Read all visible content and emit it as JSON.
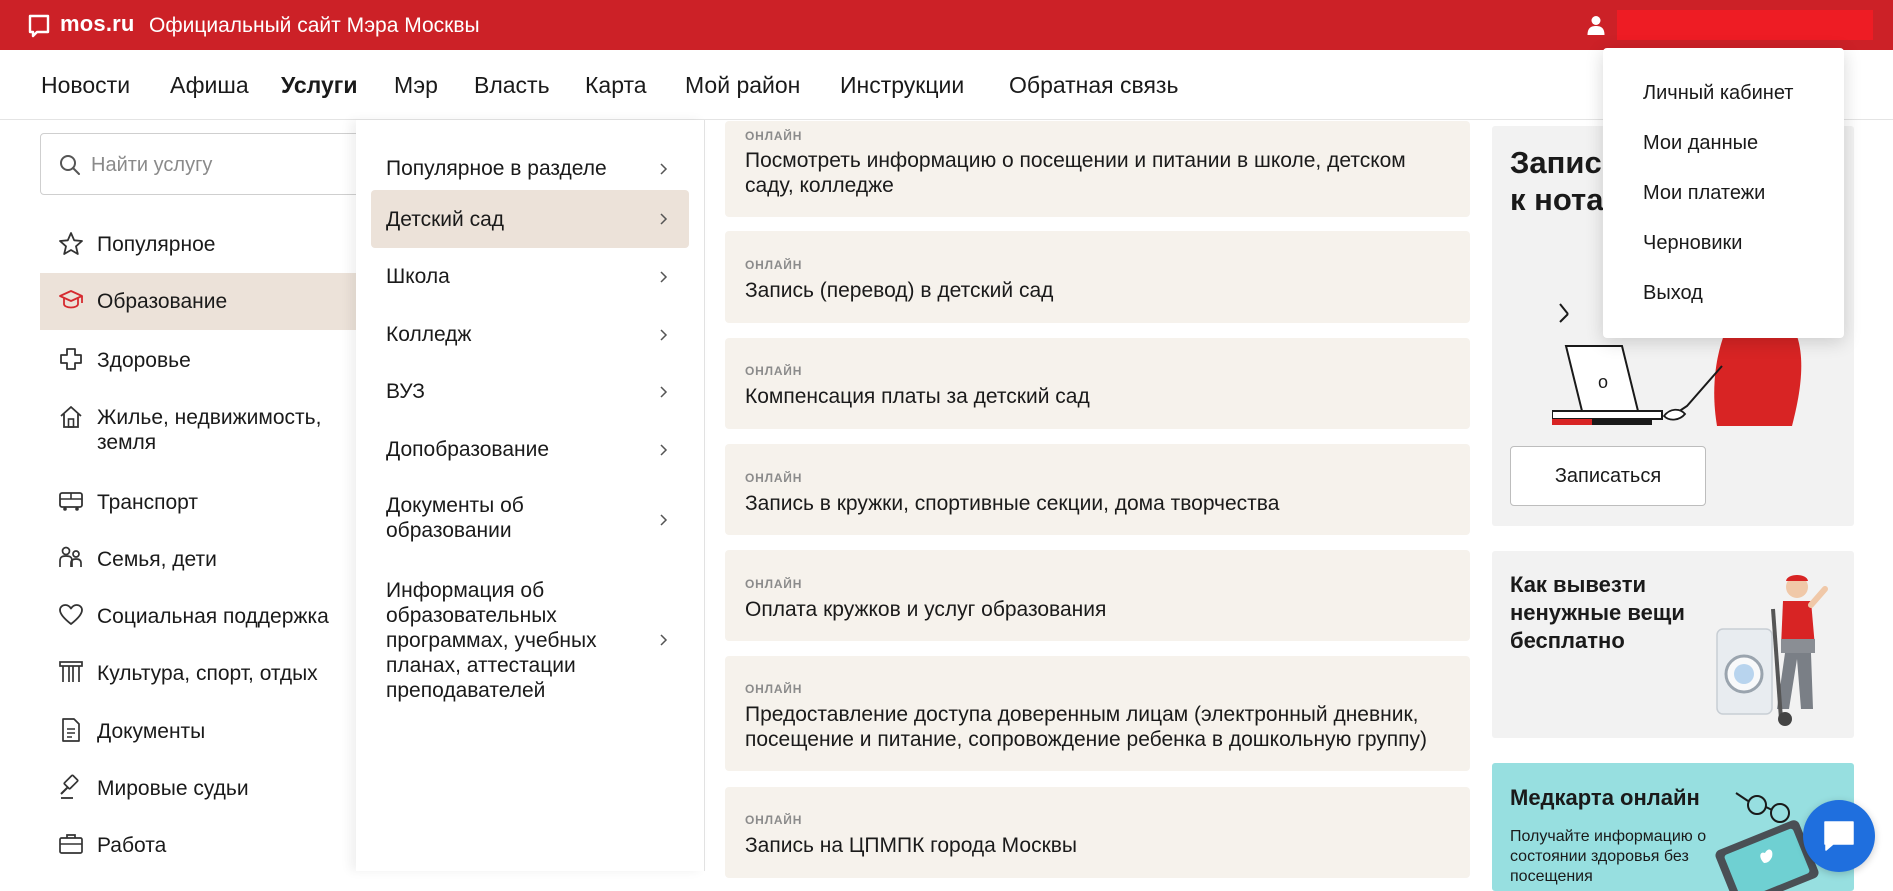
{
  "header": {
    "logo": "mos.ru",
    "site_title": "Официальный сайт Мэра Москвы",
    "user_name": "",
    "colors": {
      "brand_red": "#cc2127",
      "user_bar": "#ee1c24"
    }
  },
  "nav": {
    "items": [
      {
        "label": "Новости"
      },
      {
        "label": "Афиша"
      },
      {
        "label": "Услуги",
        "active": true
      },
      {
        "label": "Мэр"
      },
      {
        "label": "Власть"
      },
      {
        "label": "Карта"
      },
      {
        "label": "Мой район"
      },
      {
        "label": "Инструкции"
      },
      {
        "label": "Обратная связь"
      }
    ]
  },
  "search": {
    "placeholder": "Найти услугу",
    "value": ""
  },
  "categories": [
    {
      "label": "Популярное",
      "icon": "star-icon"
    },
    {
      "label": "Образование",
      "icon": "graduation-cap-icon",
      "active": true
    },
    {
      "label": "Здоровье",
      "icon": "medical-cross-icon"
    },
    {
      "label": "Жилье, недвижимость, земля",
      "icon": "house-icon"
    },
    {
      "label": "Транспорт",
      "icon": "bus-icon"
    },
    {
      "label": "Семья, дети",
      "icon": "family-icon"
    },
    {
      "label": "Социальная поддержка",
      "icon": "heart-icon"
    },
    {
      "label": "Культура, спорт, отдых",
      "icon": "theater-icon"
    },
    {
      "label": "Документы",
      "icon": "document-icon"
    },
    {
      "label": "Мировые судьи",
      "icon": "gavel-icon"
    },
    {
      "label": "Работа",
      "icon": "briefcase-icon"
    }
  ],
  "subcategories": [
    {
      "label": "Популярное в разделе"
    },
    {
      "label": "Детский сад",
      "active": true
    },
    {
      "label": "Школа"
    },
    {
      "label": "Колледж"
    },
    {
      "label": "ВУЗ"
    },
    {
      "label": "Допобразование"
    },
    {
      "label": "Документы об образовании"
    },
    {
      "label": "Информация об образовательных программах, учебных планах, аттестации преподавателей"
    }
  ],
  "services": [
    {
      "tag": "ОНЛАЙН",
      "title": "Посмотреть информацию о посещении и питании в школе, детском саду, колледже"
    },
    {
      "tag": "ОНЛАЙН",
      "title": "Запись (перевод) в детский сад"
    },
    {
      "tag": "ОНЛАЙН",
      "title": "Компенсация платы за детский сад"
    },
    {
      "tag": "ОНЛАЙН",
      "title": "Запись в кружки, спортивные секции, дома творчества"
    },
    {
      "tag": "ОНЛАЙН",
      "title": "Оплата кружков и услуг образования"
    },
    {
      "tag": "ОНЛАЙН",
      "title": "Предоставление доступа доверенным лицам (электронный дневник, посещение и питание, сопровождение ребенка в дошкольную группу)"
    },
    {
      "tag": "ОНЛАЙН",
      "title": "Запись на ЦПМПК города Москвы"
    }
  ],
  "promos": {
    "notary": {
      "title_line1": "Запис",
      "title_line2": "к нота",
      "button": "Записаться"
    },
    "junk": {
      "title": "Как вывезти ненужные вещи бесплатно"
    },
    "medcard": {
      "title": "Медкарта онлайн",
      "description": "Получайте информацию о состоянии здоровья без посещения"
    }
  },
  "user_menu": {
    "items": [
      {
        "label": "Личный кабинет"
      },
      {
        "label": "Мои данные"
      },
      {
        "label": "Мои платежи"
      },
      {
        "label": "Черновики"
      },
      {
        "label": "Выход"
      }
    ]
  }
}
